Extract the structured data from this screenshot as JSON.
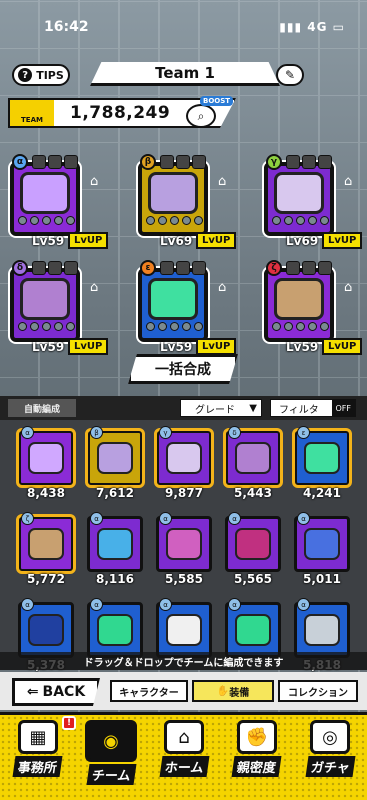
{
  "status": {
    "time": "16:42",
    "network": "4G"
  },
  "header": {
    "tips": "TIPS",
    "team_name": "Team 1",
    "edit_icon": "pencil-icon",
    "team_badge": "TEAM",
    "power": "1,788,249",
    "boost": "BOOST"
  },
  "team_slots": [
    {
      "rarity": "α",
      "level": "Lv59",
      "lvup": "LvUP",
      "bg": "#8b2bd6",
      "frame": "#8b2bd6",
      "item": "#c9a0ff",
      "rcolor": "#5aa6f0"
    },
    {
      "rarity": "β",
      "level": "Lv69",
      "lvup": "LvUP",
      "bg": "#c9a50a",
      "frame": "#c9a50a",
      "item": "#b8a0e0",
      "rcolor": "#e0a020"
    },
    {
      "rarity": "γ",
      "level": "Lv69",
      "lvup": "LvUP",
      "bg": "#7d2bd0",
      "frame": "#7d2bd0",
      "item": "#d8c8ee",
      "rcolor": "#8ed040"
    },
    {
      "rarity": "δ",
      "level": "Lv59",
      "lvup": "LvUP",
      "bg": "#7d2bd0",
      "frame": "#7d2bd0",
      "item": "#b080d0",
      "rcolor": "#a070e0"
    },
    {
      "rarity": "ε",
      "level": "Lv59",
      "lvup": "LvUP",
      "bg": "#1f5fd0",
      "frame": "#1f5fd0",
      "item": "#3fe0a0",
      "rcolor": "#f08020"
    },
    {
      "rarity": "ζ",
      "level": "Lv59",
      "lvup": "LvUP",
      "bg": "#8b2bd6",
      "frame": "#8b2bd6",
      "item": "#c8a070",
      "rcolor": "#e03040"
    }
  ],
  "merge_button": "一括合成",
  "inventory": {
    "auto": "自動編成",
    "grade": "グレード",
    "filter": "フィルタ",
    "off": "OFF",
    "items": [
      {
        "r": "α",
        "v": "8,438",
        "bg": "#8b2bd6",
        "g": "#d0a8ff",
        "gold": true
      },
      {
        "r": "β",
        "v": "7,612",
        "bg": "#c9a50a",
        "g": "#b8a0e0",
        "gold": true
      },
      {
        "r": "γ",
        "v": "9,877",
        "bg": "#7d2bd0",
        "g": "#d8c8ee",
        "gold": true
      },
      {
        "r": "δ",
        "v": "5,443",
        "bg": "#7d2bd0",
        "g": "#b080d0",
        "gold": true
      },
      {
        "r": "ε",
        "v": "4,241",
        "bg": "#1f5fd0",
        "g": "#3fe0a0",
        "gold": true
      },
      {
        "r": "ζ",
        "v": "5,772",
        "bg": "#8b2bd6",
        "g": "#c8a070",
        "gold": true
      },
      {
        "r": "α",
        "v": "8,116",
        "bg": "#7d2bd0",
        "g": "#48b0e8",
        "gold": false
      },
      {
        "r": "α",
        "v": "5,585",
        "bg": "#7d2bd0",
        "g": "#d060c0",
        "gold": false
      },
      {
        "r": "α",
        "v": "5,565",
        "bg": "#7d2bd0",
        "g": "#c03080",
        "gold": false
      },
      {
        "r": "α",
        "v": "5,011",
        "bg": "#7d2bd0",
        "g": "#4870e0",
        "gold": false
      },
      {
        "r": "α",
        "v": "5,378",
        "bg": "#1f5fd0",
        "g": "#2040a0",
        "gold": false
      },
      {
        "r": "α",
        "v": "",
        "bg": "#1f5fd0",
        "g": "#30d890",
        "gold": false
      },
      {
        "r": "α",
        "v": "",
        "bg": "#1f5fd0",
        "g": "#f0f0f0",
        "gold": false
      },
      {
        "r": "α",
        "v": "",
        "bg": "#1f5fd0",
        "g": "#30d890",
        "gold": false
      },
      {
        "r": "α",
        "v": "5,818",
        "bg": "#1f5fd0",
        "g": "#c8d0d8",
        "gold": false
      }
    ],
    "hint": "ドラッグ＆ドロップでチームに編成できます"
  },
  "subnav": {
    "back": "BACK",
    "tab_character": "キャラクター",
    "tab_equipment": "装備",
    "tab_collection": "コレクション"
  },
  "bottom_nav": [
    {
      "label": "事務所",
      "icon": "office-building-icon"
    },
    {
      "label": "チーム",
      "icon": "team-bear-icon"
    },
    {
      "label": "ホーム",
      "icon": "home-icon"
    },
    {
      "label": "親密度",
      "icon": "handshake-icon"
    },
    {
      "label": "ガチャ",
      "icon": "gacha-icon"
    }
  ],
  "alert": "!"
}
